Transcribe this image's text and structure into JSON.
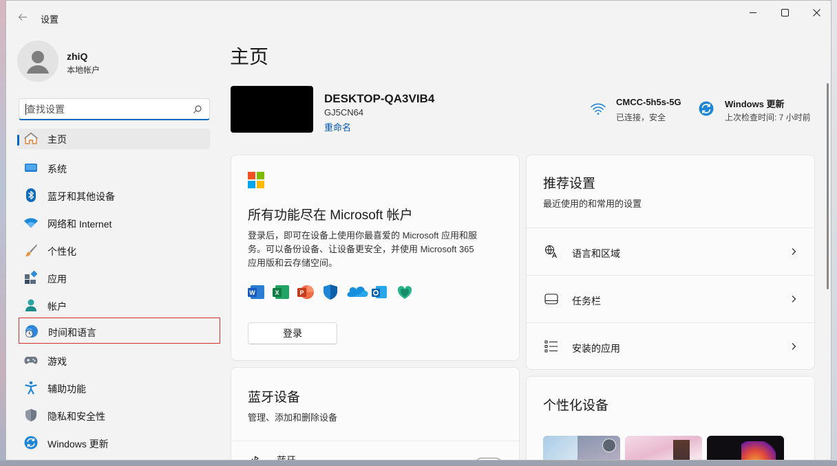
{
  "window": {
    "title": "设置",
    "back_icon": "back-arrow-icon",
    "controls": [
      "minimize-icon",
      "maximize-icon",
      "close-icon"
    ]
  },
  "user": {
    "name": "zhiQ",
    "type": "本地帐户"
  },
  "search": {
    "placeholder": "查找设置"
  },
  "sidebar": {
    "items": [
      {
        "label": "主页",
        "icon": "home-icon",
        "active": true
      },
      {
        "label": "系统",
        "icon": "system-icon"
      },
      {
        "label": "蓝牙和其他设备",
        "icon": "bluetooth-icon"
      },
      {
        "label": "网络和 Internet",
        "icon": "network-icon"
      },
      {
        "label": "个性化",
        "icon": "brush-icon"
      },
      {
        "label": "应用",
        "icon": "apps-icon"
      },
      {
        "label": "帐户",
        "icon": "account-icon"
      },
      {
        "label": "时间和语言",
        "icon": "time-language-icon",
        "focused": true
      },
      {
        "label": "游戏",
        "icon": "gamepad-icon"
      },
      {
        "label": "辅助功能",
        "icon": "accessibility-icon"
      },
      {
        "label": "隐私和安全性",
        "icon": "shield-icon"
      },
      {
        "label": "Windows 更新",
        "icon": "windows-update-icon"
      }
    ]
  },
  "main": {
    "title": "主页",
    "device": {
      "name": "DESKTOP-QA3VIB4",
      "model": "GJ5CN64",
      "rename": "重命名"
    },
    "network": {
      "name": "CMCC-5h5s-5G",
      "status": "已连接，安全"
    },
    "update": {
      "name": "Windows 更新",
      "status": "上次检查时间: 7 小时前"
    },
    "ms_card": {
      "title": "所有功能尽在 Microsoft 帐户",
      "desc_lines": [
        "登录后，即可在设备上使用你最喜爱的 Microsoft 应用和服",
        "务。可以备份设备、让设备更安全，并使用 Microsoft 365",
        "应用版和云存储空间。"
      ],
      "signin": "登录",
      "app_icons": [
        "word-icon",
        "excel-icon",
        "powerpoint-icon",
        "defender-icon",
        "onedrive-icon",
        "outlook-icon",
        "family-icon"
      ]
    },
    "recommended": {
      "title": "推荐设置",
      "subtitle": "最近使用的和常用的设置",
      "items": [
        {
          "label": "语言和区域",
          "icon": "language-icon"
        },
        {
          "label": "任务栏",
          "icon": "taskbar-icon"
        },
        {
          "label": "安装的应用",
          "icon": "installed-apps-icon"
        }
      ]
    },
    "bluetooth": {
      "title": "蓝牙设备",
      "subtitle": "管理、添加和删除设备",
      "row_label": "蓝牙"
    },
    "personalize": {
      "title": "个性化设备"
    }
  },
  "colors": {
    "accent": "#0067c0",
    "focus_outline": "#d23030"
  }
}
